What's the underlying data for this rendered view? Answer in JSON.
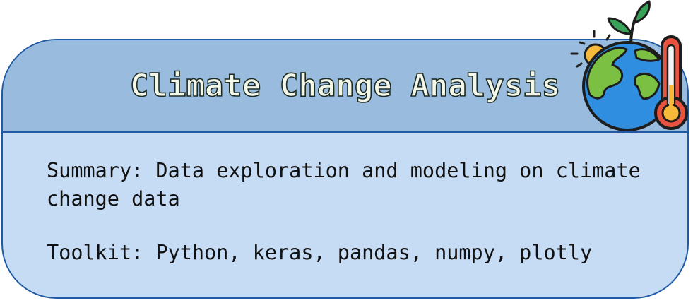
{
  "card": {
    "title": "Climate Change Analysis",
    "summary_line1": "Summary: Data exploration and modeling on climate",
    "summary_line2": "change data",
    "toolkit": "Toolkit: Python, keras, pandas, numpy, plotly"
  },
  "emblem": {
    "icons": [
      "sun-icon",
      "globe-icon",
      "plant-sprout-icon",
      "thermometer-icon"
    ]
  },
  "colors": {
    "card_border": "#1f5aa3",
    "card_body": "#c6dcf5",
    "card_header": "#99bbde",
    "globe_ocean": "#2f8ee0",
    "globe_land": "#7bc043",
    "thermometer": "#e8533f",
    "sun": "#f7b93a",
    "leaf": "#3aa35a"
  }
}
